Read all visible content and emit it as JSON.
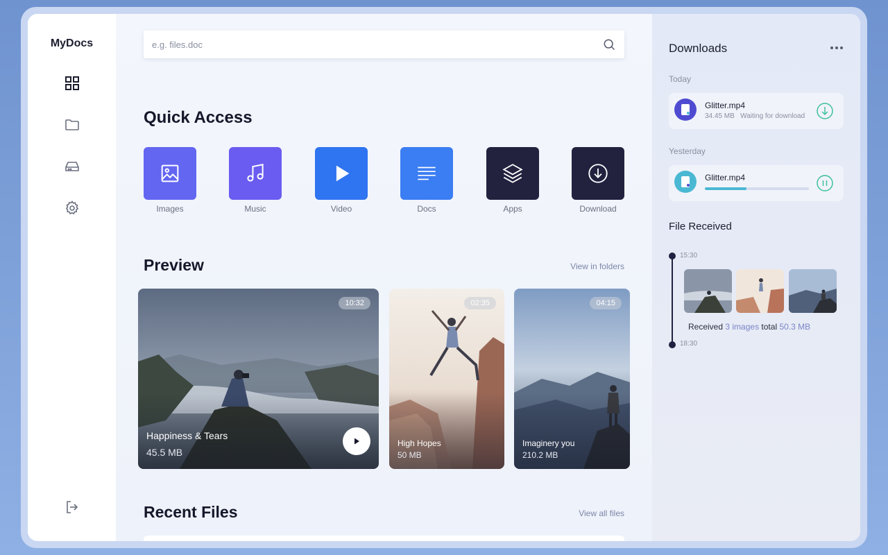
{
  "app": {
    "brand": "MyDocs"
  },
  "sidebar": {
    "items": [
      {
        "name": "dashboard",
        "icon": "grid-icon"
      },
      {
        "name": "folders",
        "icon": "folder-icon"
      },
      {
        "name": "drives",
        "icon": "hard-drive-icon"
      },
      {
        "name": "settings",
        "icon": "gear-icon"
      }
    ],
    "logout_icon": "logout-icon"
  },
  "search": {
    "placeholder": "e.g. files.doc",
    "value": ""
  },
  "quick_access": {
    "title": "Quick Access",
    "items": [
      {
        "label": "Images",
        "color": "#6366f1",
        "icon": "image-icon"
      },
      {
        "label": "Music",
        "color": "#6a5cf0",
        "icon": "music-icon"
      },
      {
        "label": "Video",
        "color": "#2f74f0",
        "icon": "play-icon"
      },
      {
        "label": "Docs",
        "color": "#3b7df2",
        "icon": "document-lines-icon"
      },
      {
        "label": "Apps",
        "color": "#22223f",
        "icon": "layers-icon"
      },
      {
        "label": "Download",
        "color": "#22223f",
        "icon": "download-circle-icon"
      }
    ]
  },
  "preview": {
    "title": "Preview",
    "link": "View in folders",
    "cards": [
      {
        "title": "Happiness & Tears",
        "size": "45.5 MB",
        "duration": "10:32"
      },
      {
        "title": "High Hopes",
        "size": "50 MB",
        "duration": "02:35"
      },
      {
        "title": "Imaginery you",
        "size": "210.2 MB",
        "duration": "04:15"
      }
    ]
  },
  "recent": {
    "title": "Recent Files",
    "link": "View all files"
  },
  "downloads": {
    "title": "Downloads",
    "more_icon": "more-horizontal-icon",
    "groups": [
      {
        "label": "Today",
        "file": "Glitter.mp4",
        "size": "34.45 MB",
        "status": "Waiting for download",
        "action_icon": "download-circle-icon",
        "accent": "#4f4bd1"
      },
      {
        "label": "Yesterday",
        "file": "Glitter.mp4",
        "progress": 0.4,
        "action_icon": "pause-circle-icon",
        "accent": "#4bb8d3"
      }
    ]
  },
  "file_received": {
    "title": "File Received",
    "start_time": "15:30",
    "end_time": "18:30",
    "text_received": "Received",
    "count_text": "3 images",
    "text_total": "total",
    "total_size": "50.3 MB"
  }
}
